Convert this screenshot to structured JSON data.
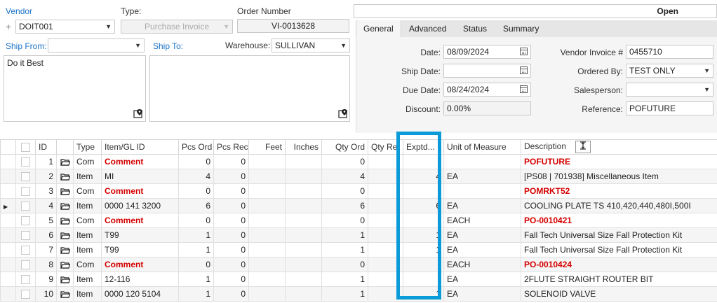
{
  "header": {
    "vendor_label": "Vendor",
    "vendor_value": "DOIT001",
    "type_label": "Type:",
    "type_value": "Purchase Invoice",
    "order_label": "Order Number",
    "order_value": "VI-0013628",
    "status": "Open"
  },
  "ship": {
    "from_label": "Ship From:",
    "from_value": "",
    "from_address": "Do it Best",
    "to_label": "Ship To:",
    "warehouse_label": "Warehouse:",
    "warehouse_value": "SULLIVAN"
  },
  "tabs": [
    {
      "label": "General"
    },
    {
      "label": "Advanced"
    },
    {
      "label": "Status"
    },
    {
      "label": "Summary"
    }
  ],
  "general": {
    "date_label": "Date:",
    "date_value": "08/09/2024",
    "ship_date_label": "Ship Date:",
    "ship_date_value": "",
    "due_date_label": "Due Date:",
    "due_date_value": "08/24/2024",
    "discount_label": "Discount:",
    "discount_value": "0.00%",
    "vendor_invoice_label": "Vendor Invoice #",
    "vendor_invoice_value": "0455710",
    "ordered_by_label": "Ordered By:",
    "ordered_by_value": "TEST ONLY",
    "salesperson_label": "Salesperson:",
    "salesperson_value": "",
    "reference_label": "Reference:",
    "reference_value": "POFUTURE"
  },
  "grid": {
    "columns": {
      "id": "ID",
      "type": "Type",
      "item": "Item/GL ID",
      "pcs_ord": "Pcs Ord",
      "pcs_rec": "Pcs Rec",
      "feet": "Feet",
      "inches": "Inches",
      "qty_ord": "Qty Ord",
      "qty_rec": "Qty Re",
      "exptd": "Exptd...",
      "uom": "Unit of Measure",
      "desc": "Description"
    },
    "rows": [
      {
        "id": "1",
        "type": "Com",
        "item": "Comment",
        "pcs_ord": "0",
        "pcs_rec": "0",
        "qty_ord": "0",
        "exptd": "",
        "uom": "",
        "desc": "POFUTURE",
        "comment": true
      },
      {
        "id": "2",
        "type": "Item",
        "item": "MI",
        "pcs_ord": "4",
        "pcs_rec": "0",
        "qty_ord": "4",
        "exptd": "4",
        "uom": "EA",
        "desc": "[PS08 | 701938] Miscellaneous Item",
        "comment": false
      },
      {
        "id": "3",
        "type": "Com",
        "item": "Comment",
        "pcs_ord": "0",
        "pcs_rec": "0",
        "qty_ord": "0",
        "exptd": "",
        "uom": "",
        "desc": "POMRKT52",
        "comment": true
      },
      {
        "id": "4",
        "type": "Item",
        "item": "0000 141 3200",
        "pcs_ord": "6",
        "pcs_rec": "0",
        "qty_ord": "6",
        "exptd": "6",
        "uom": "EA",
        "desc": "COOLING PLATE TS 410,420,440,480I,500I",
        "comment": false,
        "current": true
      },
      {
        "id": "5",
        "type": "Com",
        "item": "Comment",
        "pcs_ord": "0",
        "pcs_rec": "0",
        "qty_ord": "0",
        "exptd": "",
        "uom": "EACH",
        "desc": "PO-0010421",
        "comment": true
      },
      {
        "id": "6",
        "type": "Item",
        "item": "T99",
        "pcs_ord": "1",
        "pcs_rec": "0",
        "qty_ord": "1",
        "exptd": "1",
        "uom": "EA",
        "desc": "Fall Tech Universal Size Fall Protection Kit",
        "comment": false
      },
      {
        "id": "7",
        "type": "Item",
        "item": "T99",
        "pcs_ord": "1",
        "pcs_rec": "0",
        "qty_ord": "1",
        "exptd": "1",
        "uom": "EA",
        "desc": "Fall Tech Universal Size Fall Protection Kit",
        "comment": false
      },
      {
        "id": "8",
        "type": "Com",
        "item": "Comment",
        "pcs_ord": "0",
        "pcs_rec": "0",
        "qty_ord": "0",
        "exptd": "",
        "uom": "EACH",
        "desc": "PO-0010424",
        "comment": true
      },
      {
        "id": "9",
        "type": "Item",
        "item": "12-116",
        "pcs_ord": "1",
        "pcs_rec": "0",
        "qty_ord": "1",
        "exptd": "",
        "uom": "EA",
        "desc": "2FLUTE STRAIGHT ROUTER BIT",
        "comment": false
      },
      {
        "id": "10",
        "type": "Item",
        "item": "0000 120 5104",
        "pcs_ord": "1",
        "pcs_rec": "0",
        "qty_ord": "1",
        "exptd": "1",
        "uom": "EA",
        "desc": "SOLENOID VALVE",
        "comment": false
      }
    ]
  },
  "colors": {
    "accent": "#1a73c8",
    "comment_red": "#d40000",
    "highlight": "#0a9bd8"
  },
  "icons": {
    "add": "plus-icon",
    "folder": "folder-icon",
    "map": "map-pin-icon",
    "calendar": "calendar-icon",
    "resize": "column-fit-icon"
  }
}
